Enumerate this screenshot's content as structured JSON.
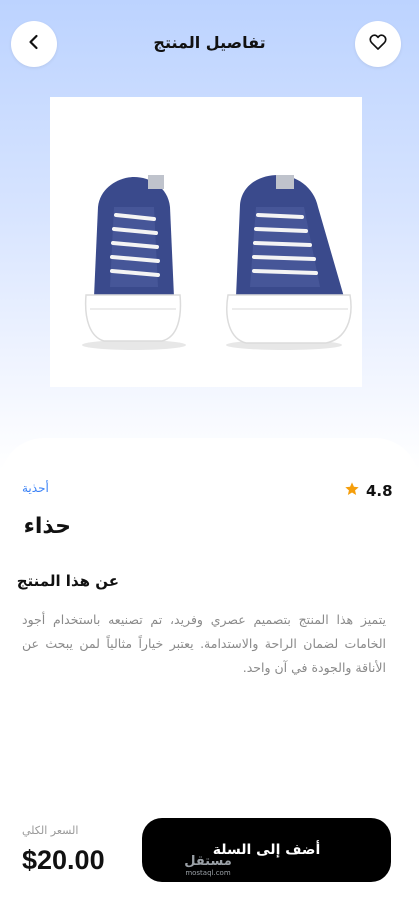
{
  "header": {
    "title": "تفاصيل المنتج",
    "back_icon": "chevron-left-icon",
    "favorite_icon": "heart-outline-icon"
  },
  "product": {
    "rating": "4.8",
    "rating_icon": "star-icon",
    "star_color": "#f59e0b",
    "category": "أحذية",
    "category_color": "#3b82f6",
    "name": "حذاء",
    "about_title": "عن هذا المنتج",
    "description": "يتميز هذا المنتج بتصميم عصري وفريد، تم تصنيعه باستخدام أجود الخامات لضمان الراحة والاستدامة. يعتبر خياراً مثالياً لمن يبحث عن الأناقة والجودة في آن واحد."
  },
  "footer": {
    "total_label": "السعر الكلي",
    "price": "$20.00",
    "add_to_cart_label": "أضف إلى السلة"
  },
  "watermark": {
    "main": "مستقل",
    "sub": "mostaql.com"
  }
}
